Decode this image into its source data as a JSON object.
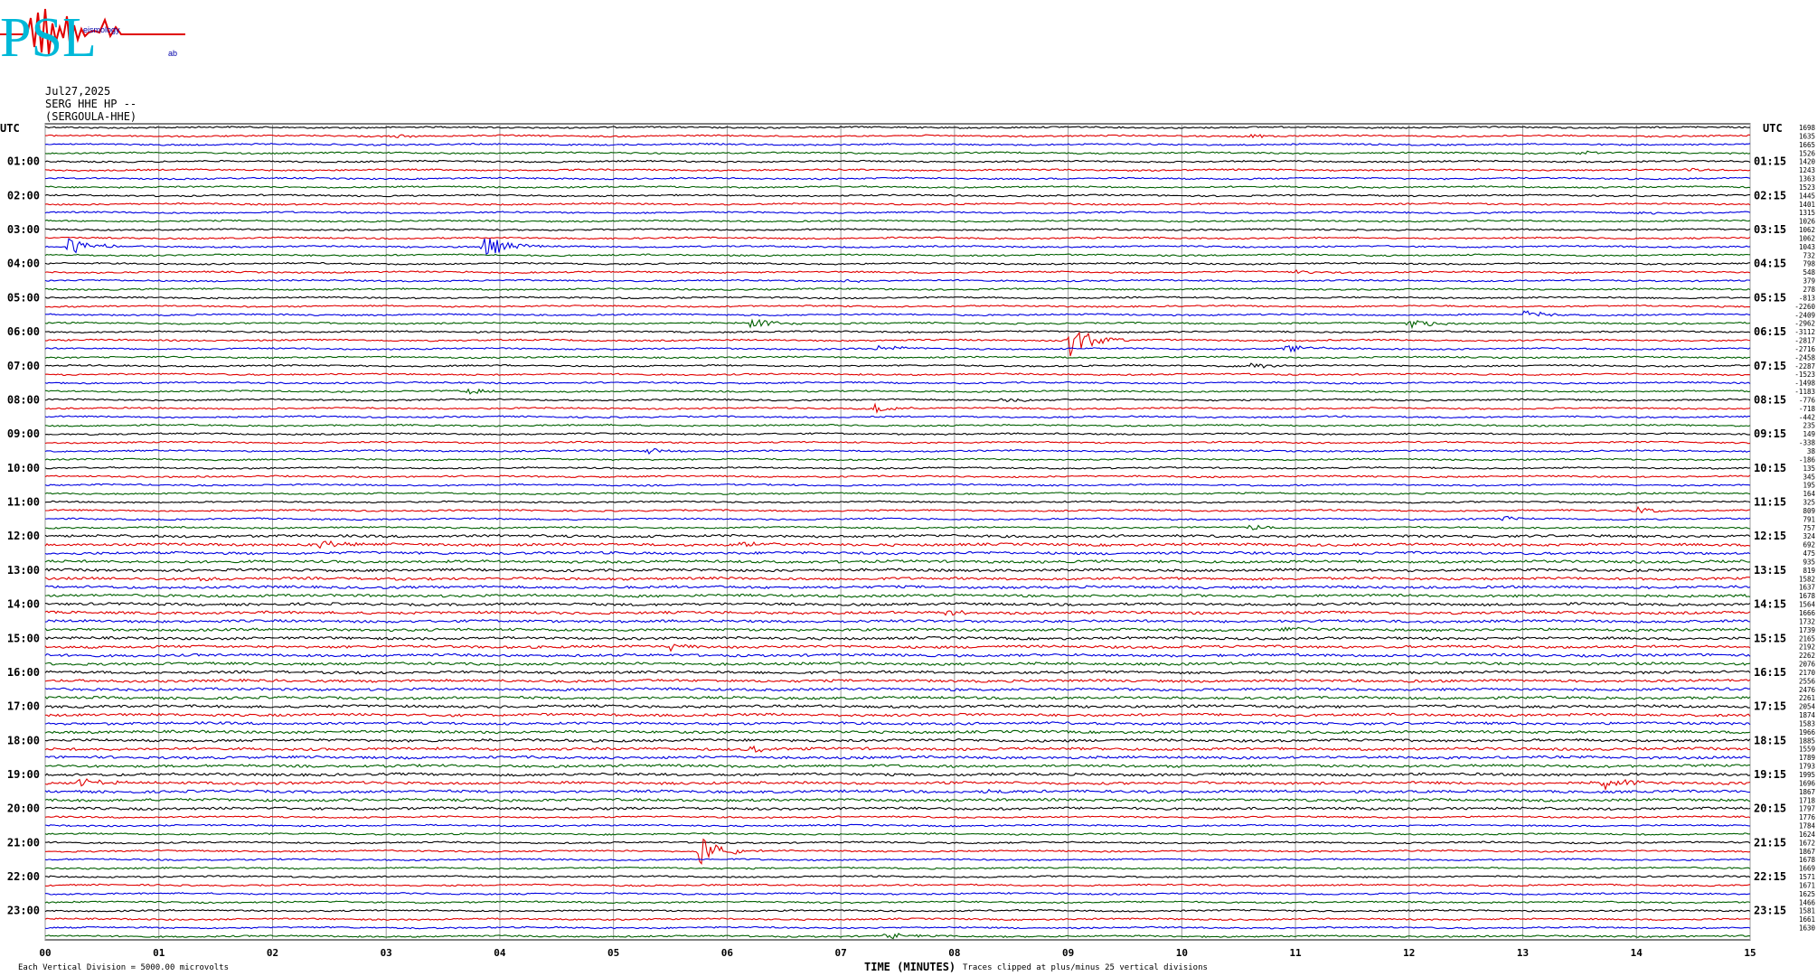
{
  "logo": {
    "letters": "PSL",
    "small_text_1": "eismology",
    "small_text_2": "ab"
  },
  "header": {
    "date": "Jul27,2025",
    "station": "SERG HHE HP --",
    "channel": "(SERGOULA-HHE)"
  },
  "axis": {
    "utc_left": "UTC",
    "utc_right": "UTC"
  },
  "footer": {
    "scale_note": "Each Vertical Division = 5000.00 microvolts",
    "xlabel": "TIME (MINUTES)",
    "clip_note": "Traces clipped at plus/minus 25 vertical divisions"
  },
  "chart_data": {
    "type": "line",
    "title": "",
    "xlabel": "TIME (MINUTES)",
    "x_ticks": [
      "00",
      "01",
      "02",
      "03",
      "04",
      "05",
      "06",
      "07",
      "08",
      "09",
      "10",
      "11",
      "12",
      "13",
      "14",
      "15"
    ],
    "xlim": [
      0,
      15
    ],
    "trace_count": 96,
    "trace_colors": [
      "#000000",
      "#e00000",
      "#0000e0",
      "#006000"
    ],
    "left_time_labels": [
      "01:00",
      "02:00",
      "03:00",
      "04:00",
      "05:00",
      "06:00",
      "07:00",
      "08:00",
      "09:00",
      "10:00",
      "11:00",
      "12:00",
      "13:00",
      "14:00",
      "15:00",
      "16:00",
      "17:00",
      "18:00",
      "19:00",
      "20:00",
      "21:00",
      "22:00",
      "23:00"
    ],
    "right_time_labels": [
      "01:15",
      "02:15",
      "03:15",
      "04:15",
      "05:15",
      "06:15",
      "07:15",
      "08:15",
      "09:15",
      "10:15",
      "11:15",
      "12:15",
      "13:15",
      "14:15",
      "15:15",
      "16:15",
      "17:15",
      "18:15",
      "19:15",
      "20:15",
      "21:15",
      "22:15",
      "23:15"
    ],
    "trace_offsets": [
      "1698",
      "1635",
      "1665",
      "1526",
      "1420",
      "1243",
      "1363",
      "1523",
      "1445",
      "1401",
      "1315",
      "1026",
      "1062",
      "1062",
      "1043",
      "732",
      "798",
      "548",
      "379",
      "278",
      "-813",
      "-2260",
      "-2409",
      "-2962",
      "-3112",
      "-2817",
      "-2716",
      "-2458",
      "-2287",
      "-1523",
      "-1498",
      "-1183",
      "-776",
      "-718",
      "-442",
      "235",
      "149",
      "-338",
      "38",
      "-186",
      "135",
      "345",
      "195",
      "164",
      "325",
      "809",
      "791",
      "757",
      "324",
      "692",
      "475",
      "935",
      "819",
      "1582",
      "1637",
      "1678",
      "1564",
      "1666",
      "1732",
      "1739",
      "2165",
      "2192",
      "2262",
      "2076",
      "2170",
      "2556",
      "2476",
      "2261",
      "2054",
      "1874",
      "1583",
      "1966",
      "1885",
      "1559",
      "1789",
      "1793",
      "1995",
      "1696",
      "1867",
      "1718",
      "1797",
      "1776",
      "1784",
      "1624",
      "1672",
      "1867",
      "1678",
      "1669",
      "1571",
      "1671",
      "1625",
      "1466",
      "1581",
      "1661",
      "1630"
    ],
    "events": [
      {
        "trace": 1,
        "minute": 3.05,
        "amp": 2
      },
      {
        "trace": 1,
        "minute": 10.6,
        "amp": 2
      },
      {
        "trace": 3,
        "minute": 13.5,
        "amp": 3
      },
      {
        "trace": 5,
        "minute": 14.4,
        "amp": 2
      },
      {
        "trace": 10,
        "minute": 14.0,
        "amp": 2
      },
      {
        "trace": 14,
        "minute": 0.2,
        "amp": 10
      },
      {
        "trace": 14,
        "minute": 3.85,
        "amp": 14
      },
      {
        "trace": 17,
        "minute": 3.5,
        "amp": 2
      },
      {
        "trace": 17,
        "minute": 11.0,
        "amp": 2
      },
      {
        "trace": 18,
        "minute": 7.0,
        "amp": 3
      },
      {
        "trace": 22,
        "minute": 13.0,
        "amp": 5
      },
      {
        "trace": 23,
        "minute": 6.2,
        "amp": 6
      },
      {
        "trace": 23,
        "minute": 12.0,
        "amp": 7
      },
      {
        "trace": 26,
        "minute": 7.3,
        "amp": 6
      },
      {
        "trace": 26,
        "minute": 10.9,
        "amp": 6
      },
      {
        "trace": 25,
        "minute": 9.0,
        "amp": 22
      },
      {
        "trace": 28,
        "minute": 10.6,
        "amp": 4
      },
      {
        "trace": 31,
        "minute": 3.7,
        "amp": 4
      },
      {
        "trace": 33,
        "minute": 7.3,
        "amp": 5
      },
      {
        "trace": 32,
        "minute": 8.4,
        "amp": 3
      },
      {
        "trace": 38,
        "minute": 5.3,
        "amp": 4
      },
      {
        "trace": 43,
        "minute": 13.8,
        "amp": 3
      },
      {
        "trace": 45,
        "minute": 14.0,
        "amp": 4
      },
      {
        "trace": 46,
        "minute": 12.8,
        "amp": 4
      },
      {
        "trace": 47,
        "minute": 10.6,
        "amp": 4
      },
      {
        "trace": 49,
        "minute": 2.4,
        "amp": 6
      },
      {
        "trace": 49,
        "minute": 6.1,
        "amp": 3
      },
      {
        "trace": 53,
        "minute": 1.3,
        "amp": 3
      },
      {
        "trace": 57,
        "minute": 7.9,
        "amp": 3
      },
      {
        "trace": 59,
        "minute": 10.9,
        "amp": 3
      },
      {
        "trace": 61,
        "minute": 5.5,
        "amp": 5
      },
      {
        "trace": 73,
        "minute": 6.2,
        "amp": 4
      },
      {
        "trace": 77,
        "minute": 0.3,
        "amp": 6
      },
      {
        "trace": 77,
        "minute": 13.7,
        "amp": 8
      },
      {
        "trace": 78,
        "minute": 8.3,
        "amp": 3
      },
      {
        "trace": 85,
        "minute": 5.75,
        "amp": 18
      },
      {
        "trace": 95,
        "minute": 7.4,
        "amp": 4
      }
    ]
  }
}
